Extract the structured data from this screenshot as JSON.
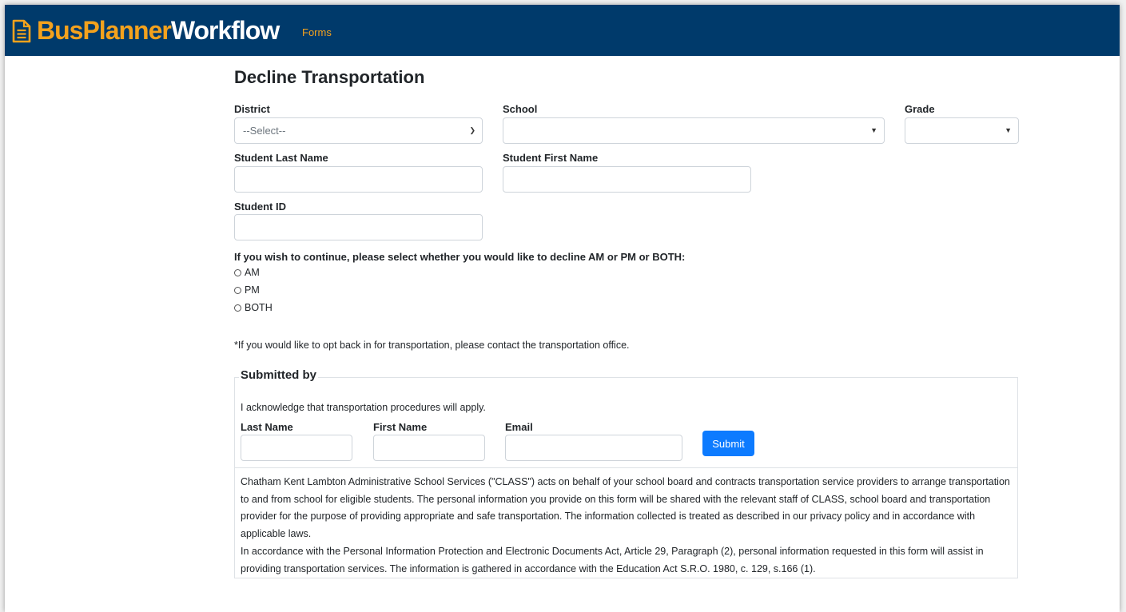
{
  "navbar": {
    "brand_part1": "Bus",
    "brand_part2": "Planner",
    "brand_part3": "Workflow",
    "nav_link": "Forms"
  },
  "colors": {
    "navbar_bg": "#003a6b",
    "brand_accent": "#f4a21d",
    "submit_button": "#0d7bff"
  },
  "form": {
    "title": "Decline Transportation",
    "district_label": "District",
    "district_value": "--Select--",
    "school_label": "School",
    "school_value": "",
    "grade_label": "Grade",
    "grade_value": "",
    "last_name_label": "Student Last Name",
    "first_name_label": "Student First Name",
    "student_id_label": "Student ID",
    "question": "If you wish to continue, please select whether you would like to decline AM or PM or BOTH:",
    "options": [
      "AM",
      "PM",
      "BOTH"
    ],
    "opt_back_note": "*If you would like to opt back in for transportation, please contact the transportation office."
  },
  "submitted_by": {
    "legend": "Submitted by",
    "acknowledge": "I acknowledge that transportation procedures will apply.",
    "last_name_label": "Last Name",
    "first_name_label": "First Name",
    "email_label": "Email",
    "submit_label": "Submit"
  },
  "privacy": {
    "paragraph1": "Chatham Kent Lambton Administrative School Services (\"CLASS\") acts on behalf of your school board and contracts transportation service providers to arrange transportation to and from school for eligible students. The personal information you provide on this form will be shared with the relevant staff of CLASS, school board and transportation provider for the purpose of providing appropriate and safe transportation. The information collected is treated as described in our privacy policy and in accordance with applicable laws.",
    "paragraph2": "In accordance with the Personal Information Protection and Electronic Documents Act, Article 29, Paragraph (2), personal information requested in this form will assist in providing transportation services. The information is gathered in accordance with the Education Act S.R.O. 1980, c. 129, s.166 (1)."
  }
}
